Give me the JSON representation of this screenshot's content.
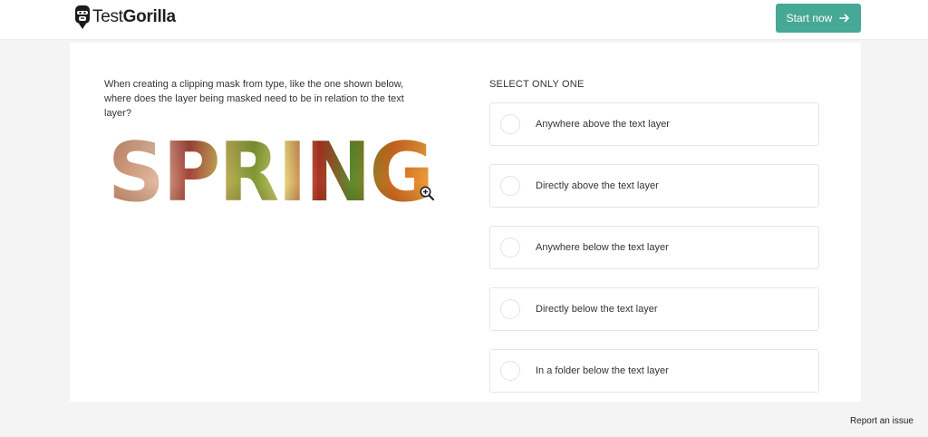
{
  "brand": {
    "logo_icon": "gorilla-icon",
    "name_light": "Test",
    "name_bold": "Gorilla",
    "accent": "#46a995"
  },
  "header": {
    "start_label": "Start now",
    "start_icon": "arrow-right-icon"
  },
  "question": {
    "text": "When creating a clipping mask from type, like the one shown below, where does the layer being masked need to be in relation to the text layer?",
    "image_word": "SPRING",
    "zoom_icon": "zoom-in-icon"
  },
  "answers": {
    "instruction": "SELECT ONLY ONE",
    "options": [
      "Anywhere above the text layer",
      "Directly above the text layer",
      "Anywhere below the text layer",
      "Directly below the text layer",
      "In a folder below the text layer"
    ]
  },
  "footer": {
    "report_label": "Report an issue"
  }
}
